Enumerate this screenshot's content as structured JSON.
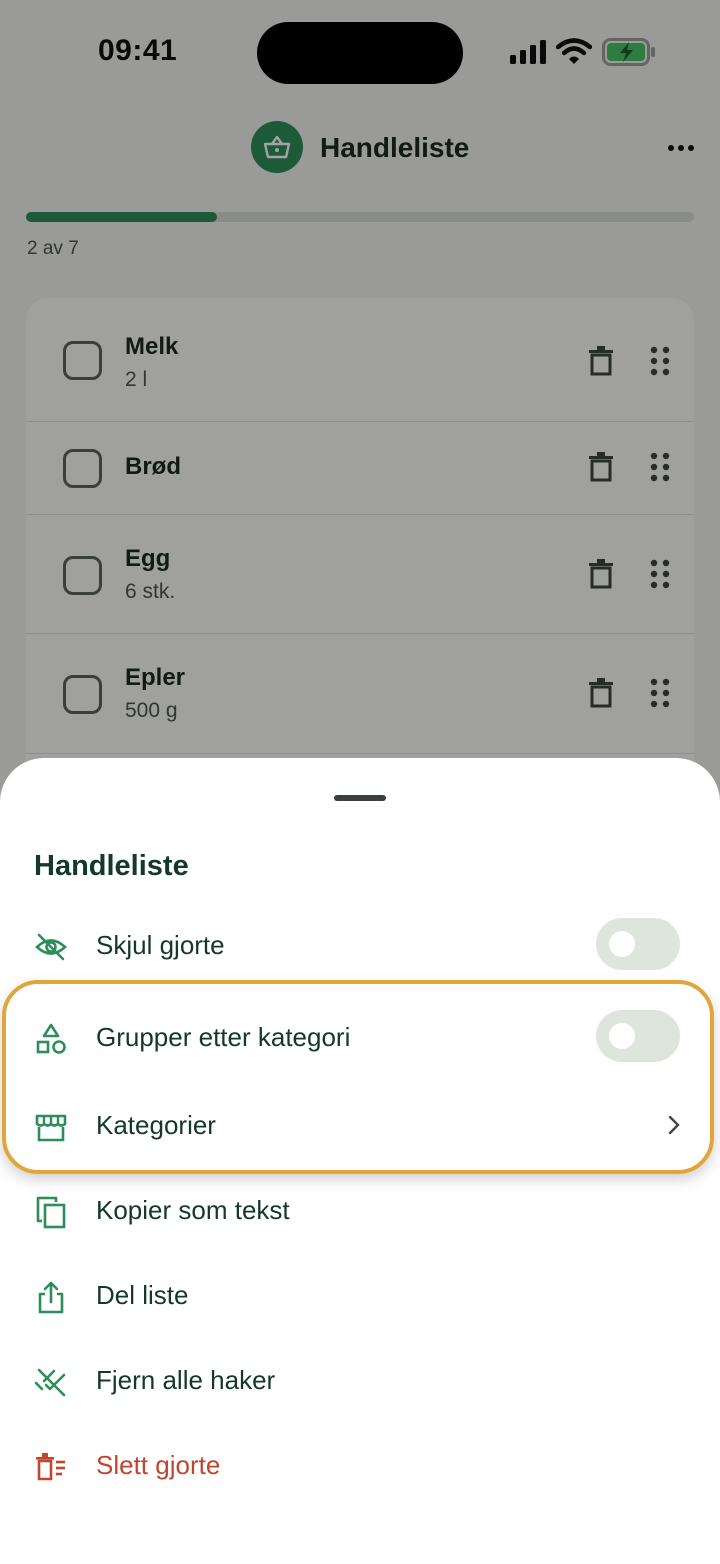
{
  "status_bar": {
    "time": "09:41"
  },
  "header": {
    "title": "Handleliste"
  },
  "progress": {
    "text": "2 av 7",
    "done": 2,
    "total": 7
  },
  "items": [
    {
      "name": "Melk",
      "qty": "2 l"
    },
    {
      "name": "Brød",
      "qty": ""
    },
    {
      "name": "Egg",
      "qty": "6 stk."
    },
    {
      "name": "Epler",
      "qty": "500 g"
    }
  ],
  "sheet": {
    "title": "Handleliste",
    "options": {
      "hide_done": {
        "label": "Skjul gjorte",
        "on": false
      },
      "group_by_category": {
        "label": "Grupper etter kategori",
        "on": false
      },
      "categories": {
        "label": "Kategorier"
      },
      "copy_text": {
        "label": "Kopier som tekst"
      },
      "share": {
        "label": "Del liste"
      },
      "remove_checks": {
        "label": "Fjern alle haker"
      },
      "delete_done": {
        "label": "Slett gjorte"
      }
    }
  },
  "colors": {
    "accent": "#2e8d5a",
    "danger": "#c1452f",
    "highlight": "#e0a63a",
    "text_dark": "#14382a"
  }
}
